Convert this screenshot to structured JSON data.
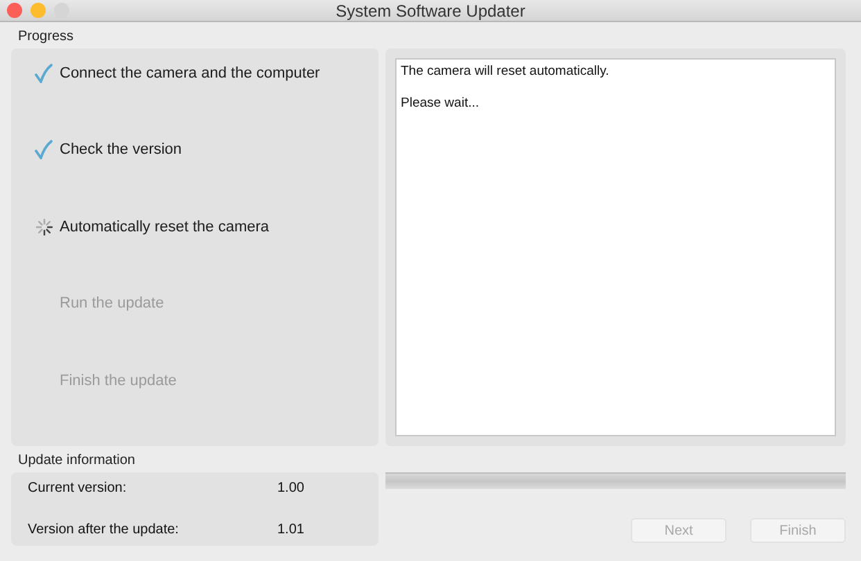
{
  "window": {
    "title": "System Software Updater"
  },
  "progress": {
    "label": "Progress",
    "steps": [
      {
        "label": "Connect the camera and the computer",
        "kind": "done"
      },
      {
        "label": "Check the version",
        "kind": "done"
      },
      {
        "label": "Automatically reset the camera",
        "kind": "active"
      },
      {
        "label": "Run the update",
        "kind": "pending"
      },
      {
        "label": "Finish the update",
        "kind": "pending"
      }
    ]
  },
  "message": {
    "lines": [
      "The camera will reset automatically.",
      "Please wait..."
    ]
  },
  "update_information": {
    "label": "Update information",
    "rows": [
      {
        "name": "Current version:",
        "value": "1.00"
      },
      {
        "name": "Version after the update:",
        "value": "1.01"
      }
    ]
  },
  "progress_bar": {
    "level": 0
  },
  "buttons": [
    {
      "label": "Next",
      "disabled": true
    },
    {
      "label": "Finish",
      "disabled": true
    }
  ]
}
